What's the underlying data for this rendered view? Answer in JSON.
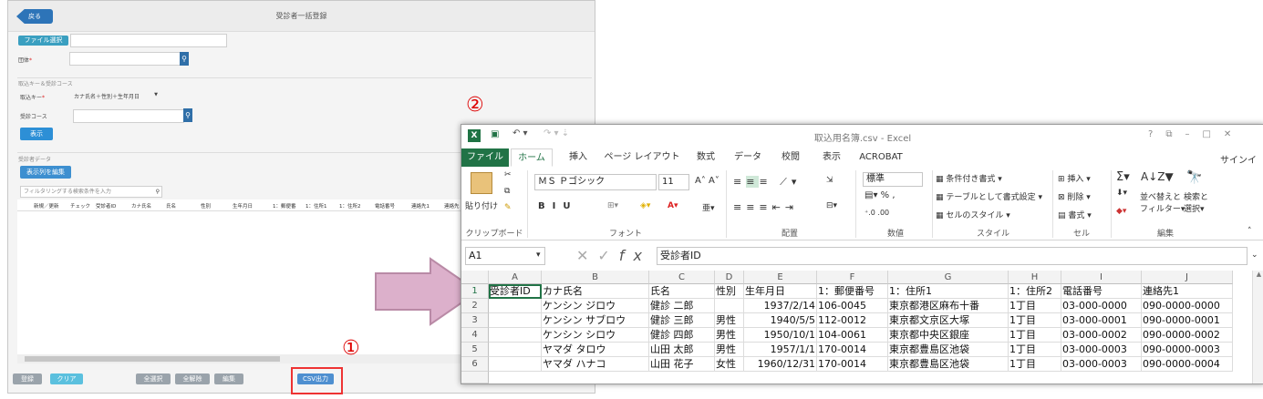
{
  "markers": {
    "one": "①",
    "two": "②"
  },
  "webapp": {
    "back_label": "戻る",
    "page_title": "受診者一括登録",
    "file_select_label": "ファイル選択",
    "group_label": "団体",
    "group_required": "*",
    "import_section": "取込キー＆受診コース",
    "import_key_label": "取込キー",
    "import_key_required": "*",
    "import_key_value": "カナ氏名＋性別＋生年月日",
    "course_label": "受診コース",
    "show_button": "表示",
    "data_section": "受診者データ",
    "edit_columns_button": "表示列を編集",
    "filter_placeholder": "フィルタリングする検索条件を入力",
    "columns": [
      "新規／更新",
      "チェック",
      "受診者ID",
      "カナ氏名",
      "氏名",
      "性別",
      "生年月日",
      "1：郵便番",
      "1：住所1",
      "1：住所2",
      "電話番号",
      "連絡先1",
      "連絡先"
    ],
    "footer": {
      "register": "登録",
      "clear": "クリア",
      "select_all": "全選択",
      "deselect_all": "全解除",
      "edit": "編集",
      "csv_export": "CSV出力"
    }
  },
  "excel": {
    "title": "取込用名簿.csv - Excel",
    "title_controls": "?",
    "tabs": [
      "ファイル",
      "ホーム",
      "挿入",
      "ページ レイアウト",
      "数式",
      "データ",
      "校閲",
      "表示",
      "ACROBAT"
    ],
    "signin": "サインイン",
    "ribbon": {
      "paste": "貼り付け",
      "clipboard": "クリップボード",
      "font_name": "ＭＳ Ｐゴシック",
      "font_size": "11",
      "font_group": "フォント",
      "align_group": "配置",
      "number_format": "標準",
      "number_group": "数値",
      "cond_format": "条件付き書式",
      "table_format": "テーブルとして書式設定",
      "cell_style": "セルのスタイル",
      "style_group": "スタイル",
      "insert": "挿入",
      "delete": "削除",
      "format": "書式",
      "cell_group": "セル",
      "sort_filter": "並べ替えと",
      "sort_filter2": "フィルター",
      "find_select": "検索と",
      "find_select2": "選択",
      "edit_group": "編集"
    },
    "name_box": "A1",
    "formula": "受診者ID",
    "col_letters": [
      "A",
      "B",
      "C",
      "D",
      "E",
      "F",
      "G",
      "H",
      "I",
      "J"
    ],
    "rows": [
      {
        "n": "1",
        "c": [
          "受診者ID",
          "カナ氏名",
          "氏名",
          "性別",
          "生年月日",
          "1：郵便番号",
          "1：住所1",
          "1：住所2",
          "電話番号",
          "連絡先1"
        ]
      },
      {
        "n": "2",
        "c": [
          "",
          "ケンシン ジロウ",
          "健診 二郎",
          "",
          "1937/2/14",
          "106-0045",
          "東京都港区麻布十番",
          "1丁目",
          "03-000-0000",
          "090-0000-0000"
        ]
      },
      {
        "n": "3",
        "c": [
          "",
          "ケンシン サブロウ",
          "健診 三郎",
          "男性",
          "1940/5/5",
          "112-0012",
          "東京都文京区大塚",
          "1丁目",
          "03-000-0001",
          "090-0000-0001"
        ]
      },
      {
        "n": "4",
        "c": [
          "",
          "ケンシン シロウ",
          "健診 四郎",
          "男性",
          "1950/10/1",
          "104-0061",
          "東京都中央区銀座",
          "1丁目",
          "03-000-0002",
          "090-0000-0002"
        ]
      },
      {
        "n": "5",
        "c": [
          "",
          "ヤマダ タロウ",
          "山田 太郎",
          "男性",
          "1957/1/1",
          "170-0014",
          "東京都豊島区池袋",
          "1丁目",
          "03-000-0003",
          "090-0000-0003"
        ]
      },
      {
        "n": "6",
        "c": [
          "",
          "ヤマダ ハナコ",
          "山田 花子",
          "女性",
          "1960/12/31",
          "170-0014",
          "東京都豊島区池袋",
          "1丁目",
          "03-000-0003",
          "090-0000-0004"
        ]
      }
    ]
  },
  "colors": {
    "accent": "#2d8fd6",
    "excel_green": "#217346",
    "arrow": "#d9a7c7",
    "marker": "#d00000"
  }
}
